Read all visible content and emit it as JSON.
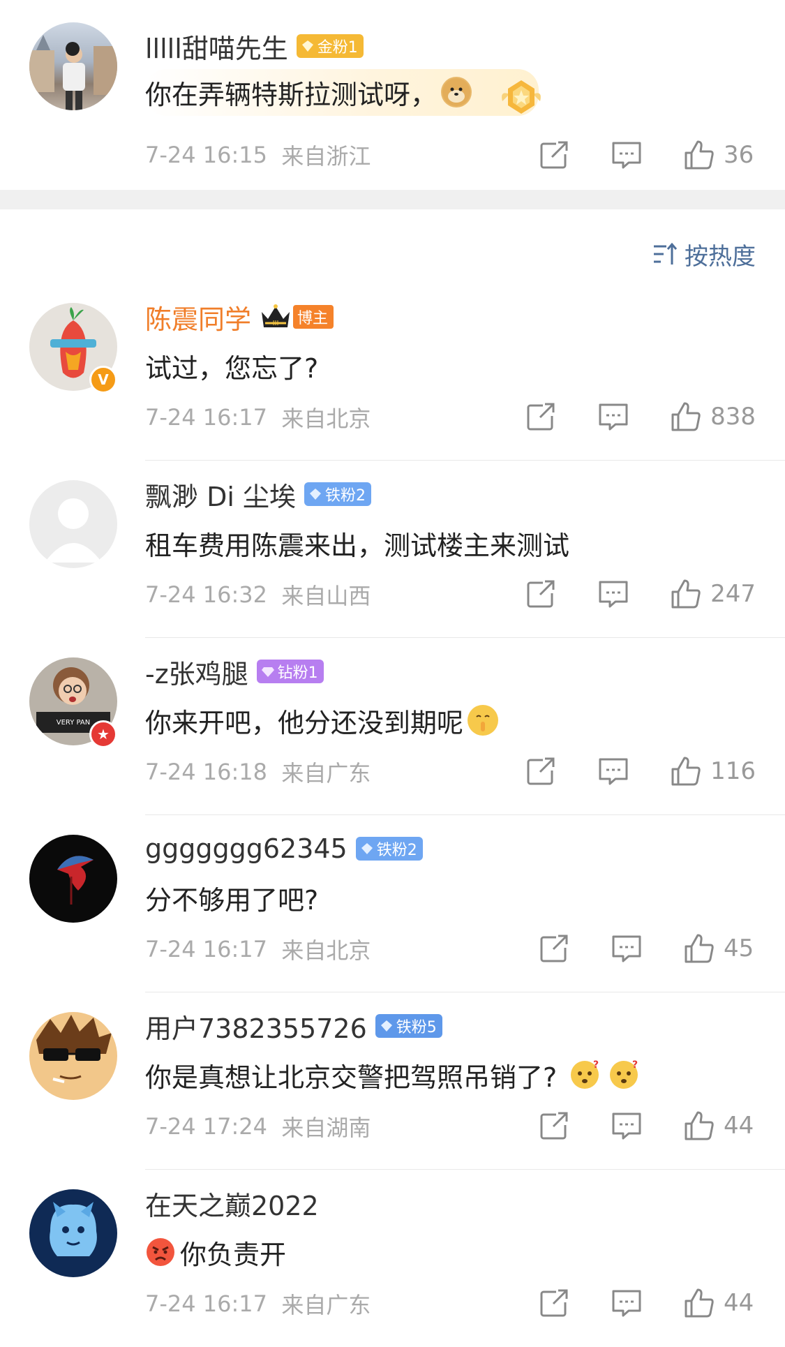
{
  "top_comment": {
    "user": "lllll甜喵先生",
    "badge": "金粉1",
    "content": "你在弄辆特斯拉测试呀，",
    "time": "7-24 16:15",
    "location": "来自浙江",
    "likes": "36"
  },
  "sort": {
    "label": "按热度"
  },
  "comments": [
    {
      "user": "陈震同学",
      "badge": "博主",
      "content": "试过，您忘了?",
      "time": "7-24 16:17",
      "location": "来自北京",
      "likes": "838"
    },
    {
      "user": "飘渺 Di 尘埃",
      "badge": "铁粉2",
      "content": "租车费用陈震来出，测试楼主来测试",
      "time": "7-24 16:32",
      "location": "来自山西",
      "likes": "247"
    },
    {
      "user": "-z张鸡腿",
      "badge": "钻粉1",
      "content": "你来开吧，他分还没到期呢",
      "time": "7-24 16:18",
      "location": "来自广东",
      "likes": "116"
    },
    {
      "user": "ggggggg62345",
      "badge": "铁粉2",
      "content": "分不够用了吧?",
      "time": "7-24 16:17",
      "location": "来自北京",
      "likes": "45"
    },
    {
      "user": "用户7382355726",
      "badge": "铁粉5",
      "content": "你是真想让北京交警把驾照吊销了?",
      "time": "7-24 17:24",
      "location": "来自湖南",
      "likes": "44"
    },
    {
      "user": "在天之巅2022",
      "badge": "",
      "content": "你负责开",
      "time": "7-24 16:17",
      "location": "来自广东",
      "likes": "44"
    }
  ],
  "colors": {
    "gold_badge": "#f5b935",
    "iron_badge": "#6ea6f2",
    "diamond_badge": "#b77ef0",
    "blogger_badge": "#f5822a",
    "vip_name": "#f07e2a",
    "link_blue": "#4e6f9a"
  },
  "icons": [
    "share-icon",
    "comment-icon",
    "like-icon",
    "sort-icon",
    "verified-v-icon"
  ]
}
